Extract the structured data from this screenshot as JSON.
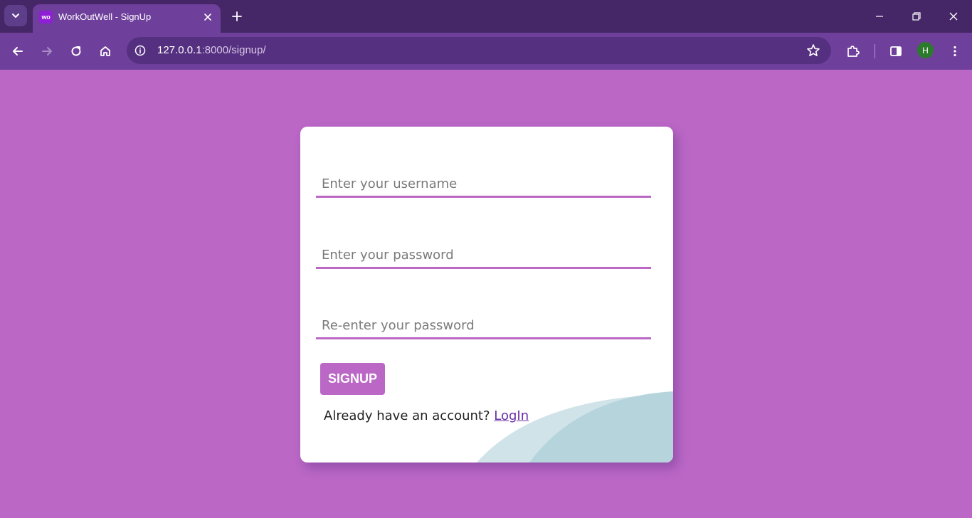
{
  "browser": {
    "tab": {
      "favicon_text": "wo",
      "title": "WorkOutWell - SignUp"
    },
    "address_bar": {
      "url_host": "127.0.0.1",
      "url_path": ":8000/signup/"
    },
    "profile_initial": "H",
    "icons": {
      "tab_search": "chevron-down-icon",
      "tab_close": "close-icon",
      "new_tab": "plus-icon",
      "minimize": "minimize-icon",
      "restore": "restore-icon",
      "close_window": "close-icon",
      "back": "arrow-left-icon",
      "forward": "arrow-right-icon",
      "reload": "reload-icon",
      "home": "home-icon",
      "site_info": "info-icon",
      "bookmark": "star-icon",
      "extensions": "puzzle-icon",
      "side_panel": "side-panel-icon",
      "menu": "kebab-menu-icon"
    }
  },
  "form": {
    "username_placeholder": "Enter your username",
    "password_placeholder": "Enter your password",
    "confirm_password_placeholder": "Re-enter your password",
    "signup_label": "SIGNUP",
    "login_prompt": "Already have an account?",
    "login_link": "LogIn"
  },
  "colors": {
    "page_background": "#ba67c6",
    "accent": "#ba67c6",
    "chrome_dark": "#452767",
    "chrome_toolbar": "#6e3f9b",
    "wave_light": "#cfe3e8",
    "wave_dark": "#b5d4dc"
  }
}
